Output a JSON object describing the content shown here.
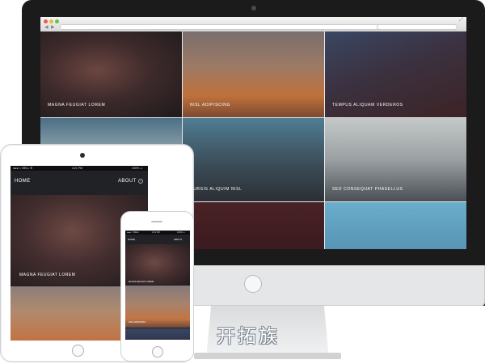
{
  "browser": {
    "url": "",
    "search_placeholder": ""
  },
  "desktop_tiles": [
    {
      "label": "MAGNA FEUGIAT LOREM",
      "gradient": "radial-gradient(ellipse at 40% 45%, #6b4640 0%, #3e2a2b 45%, #1e1a1c 100%)"
    },
    {
      "label": "NISL ADIPISCING",
      "gradient": "linear-gradient(180deg, #7a6e6c 0%, #9c7a66 40%, #c0713a 75%, #7b4a33 100%)"
    },
    {
      "label": "TEMPUS ALIQUAM VERDEROS",
      "gradient": "linear-gradient(160deg, #3a4763 0%, #3b3140 45%, #3d2325 100%)"
    },
    {
      "label": "",
      "gradient": "linear-gradient(180deg, #4b6f86 0%, #8fa3aa 40%, #cdd3d4 70%, #b8c0c2 100%)"
    },
    {
      "label": "CURSIS ALIQUIM NISL",
      "gradient": "linear-gradient(180deg, #4f7d94 0%, #3c4d58 55%, #2b2f34 100%)"
    },
    {
      "label": "SED CONSEQUAT PHASELLUS",
      "gradient": "linear-gradient(180deg, #c4c8c8 0%, #9aa0a2 50%, #4a4f55 100%)"
    },
    {
      "label": "",
      "gradient": "linear-gradient(180deg, #5b8cab 0%, #3c6f92 100%)"
    },
    {
      "label": "",
      "gradient": "linear-gradient(180deg, #4a2226 0%, #3a1b20 100%)"
    },
    {
      "label": "",
      "gradient": "linear-gradient(180deg, #6aaecb 0%, #5795b4 100%)"
    }
  ],
  "ipad": {
    "status": {
      "carrier": "●●●○○ BELL ☰",
      "time": "4:21 PM",
      "battery": "100% ▭"
    },
    "nav": {
      "home": "HOME",
      "about": "ABOUT",
      "info_icon": "i"
    },
    "tiles": [
      {
        "label": "MAGNA FEUGIAT LOREM",
        "gradient": "radial-gradient(ellipse at 45% 40%, #6d4944 0%, #432d2e 45%, #221c1e 100%)"
      },
      {
        "label": "",
        "gradient": "linear-gradient(180deg, #8b7d79 0%, #b08a6f 45%, #c27443 100%)"
      }
    ]
  },
  "iphone": {
    "status": {
      "carrier": "●●●○○ BELL",
      "time": "4:21 PM",
      "battery": "100% ▭"
    },
    "nav": {
      "home": "HOME",
      "about": "ABOUT"
    },
    "tiles": [
      {
        "label": "MAGNA FEUGIAT LOREM",
        "gradient": "radial-gradient(ellipse at 45% 45%, #6d4944 0%, #432d2e 50%, #221c1e 100%)"
      },
      {
        "label": "NISL ADIPISCING",
        "gradient": "linear-gradient(180deg, #86787a 0%, #a8836b 45%, #c27443 80%, #6e4a3a 100%)"
      },
      {
        "label": "",
        "gradient": "linear-gradient(180deg, #3a4763 0%, #30374d 100%)"
      }
    ]
  },
  "watermark": "开拓族",
  "colors": {
    "bezel": "#1b1b1b",
    "stand": "#e4e6e8",
    "accent_orange": "#c0713a"
  }
}
